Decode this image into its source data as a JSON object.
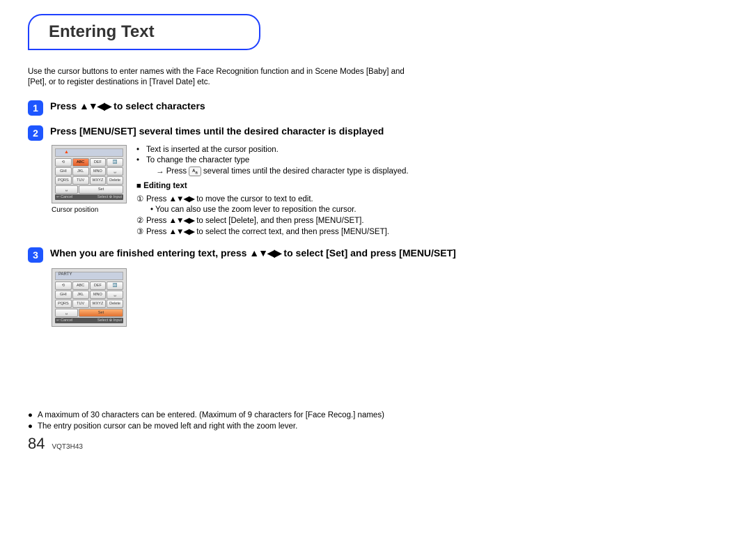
{
  "title": "Entering Text",
  "intro": "Use the cursor buttons to enter names with the Face Recognition function and in Scene Modes [Baby] and [Pet], or to register destinations in [Travel Date] etc.",
  "steps": {
    "s1": {
      "num": "1",
      "heading_pre": "Press ",
      "heading_post": " to select characters"
    },
    "s2": {
      "num": "2",
      "heading": "Press [MENU/SET] several times until the desired character is displayed",
      "caption": "Cursor position",
      "b1": "Text is inserted at the cursor position.",
      "b2": "To change the character type",
      "b2a_pre": "→ Press ",
      "b2a_post": " several times until the desired character type is displayed.",
      "editing_head": "Editing text",
      "e1_post": " to move the cursor to text to edit.",
      "e1_sub": "You can also use the zoom lever to reposition the cursor.",
      "e2_post": " to select [Delete], and then press [MENU/SET].",
      "e3_post": " to select the correct text, and then press [MENU/SET]."
    },
    "s3": {
      "num": "3",
      "heading_pre": "When you are finished entering text, press ",
      "heading_post": " to select [Set] and press [MENU/SET]",
      "party": "PARTY"
    }
  },
  "keypad": {
    "r1": [
      "⟲",
      "ABC",
      "DEF",
      "🔤"
    ],
    "r2": [
      "GHI",
      "JKL",
      "MNO",
      "␣"
    ],
    "r3": [
      "PQRS",
      "TUV",
      "WXYZ",
      "Delete"
    ],
    "set_left": "␣",
    "set_right": "Set",
    "cancel": "↩ Cancel",
    "select": "Select ⊕ Input"
  },
  "notes": {
    "n1": "A maximum of 30 characters can be entered. (Maximum of 9 characters for [Face Recog.] names)",
    "n2": "The entry position cursor can be moved left and right with the zoom lever."
  },
  "page": {
    "num": "84",
    "docid": "VQT3H43"
  }
}
